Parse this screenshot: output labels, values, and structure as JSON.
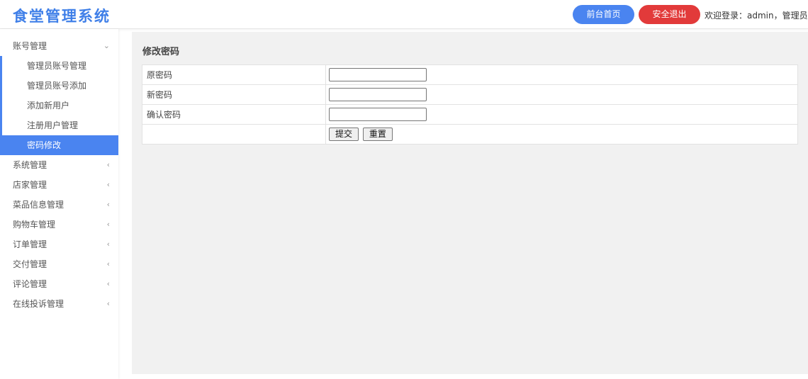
{
  "header": {
    "title": "食堂管理系统",
    "front_button": "前台首页",
    "logout_button": "安全退出",
    "welcome": "欢迎登录：admin，管理员"
  },
  "sidebar": {
    "groups": [
      {
        "label": "账号管理",
        "icon": "chevron-down-icon",
        "expanded": true,
        "items": [
          "管理员账号管理",
          "管理员账号添加",
          "添加新用户",
          "注册用户管理",
          "密码修改"
        ],
        "active_item": "密码修改"
      },
      {
        "label": "系统管理",
        "icon": "chevron-left-icon"
      },
      {
        "label": "店家管理",
        "icon": "chevron-left-icon"
      },
      {
        "label": "菜品信息管理",
        "icon": "chevron-left-icon"
      },
      {
        "label": "购物车管理",
        "icon": "chevron-left-icon"
      },
      {
        "label": "订单管理",
        "icon": "chevron-left-icon"
      },
      {
        "label": "交付管理",
        "icon": "chevron-left-icon"
      },
      {
        "label": "评论管理",
        "icon": "chevron-left-icon"
      },
      {
        "label": "在线投诉管理",
        "icon": "chevron-left-icon"
      }
    ]
  },
  "main": {
    "title": "修改密码",
    "form": {
      "old_password_label": "原密码",
      "new_password_label": "新密码",
      "confirm_password_label": "确认密码",
      "old_password_value": "",
      "new_password_value": "",
      "confirm_password_value": "",
      "submit_label": "提交",
      "reset_label": "重置"
    }
  },
  "colors": {
    "accent": "#4a84f0",
    "logout": "#e23a3a",
    "logo": "#3f7fe8",
    "content_bg": "#f1f1f1"
  }
}
